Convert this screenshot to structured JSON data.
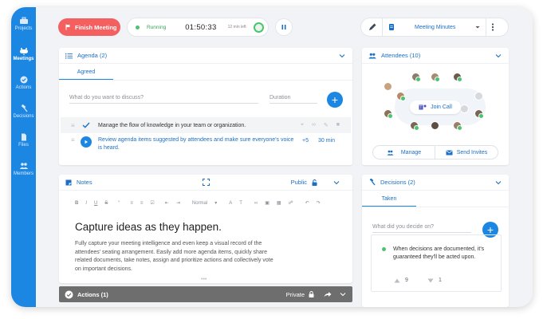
{
  "sidebar": {
    "items": [
      {
        "label": "Projects",
        "icon": "briefcase-icon"
      },
      {
        "label": "Meetings",
        "icon": "meetings-icon",
        "active": true
      },
      {
        "label": "Actions",
        "icon": "check-circle-icon"
      },
      {
        "label": "Decisions",
        "icon": "gavel-icon"
      },
      {
        "label": "Files",
        "icon": "file-icon"
      },
      {
        "label": "Members",
        "icon": "people-icon"
      }
    ]
  },
  "toolbar": {
    "finish_label": "Finish Meeting",
    "status": "Running",
    "clock": "01:50:33",
    "time_left": "12 min left",
    "template_label": "Meeting Minutes"
  },
  "agenda": {
    "title": "Agenda (2)",
    "tab": "Agreed",
    "input_placeholder": "What do you want to discuss?",
    "duration_placeholder": "Duration",
    "items": [
      {
        "text": "Manage the flow of knowledge in your team or organization."
      },
      {
        "text": "Review agenda items suggested by attendees and make sure everyone's voice is heard.",
        "votes": "+5",
        "duration": "30 min"
      }
    ]
  },
  "notes": {
    "title": "Notes",
    "visibility": "Public",
    "format_label": "Normal",
    "heading": "Capture ideas as they happen.",
    "body": "Fully capture your meeting intelligence and even keep a visual record of the attendees' seating arrangement. Easily add more agenda items, quickly share related documents, take notes, assign and prioritize actions and collectively vote on important decisions."
  },
  "actions": {
    "title": "Actions (1)",
    "visibility": "Private"
  },
  "attendees": {
    "title": "Attendees (10)",
    "join_label": "Join Call",
    "manage_label": "Manage",
    "invite_label": "Send Invites"
  },
  "decisions": {
    "title": "Decisions (2)",
    "tab": "Taken",
    "input_placeholder": "What did you decide on?",
    "item_text": "When decisions are documented, it's guaranteed they'll be acted upon.",
    "upvotes": "9",
    "downvotes": "1"
  },
  "colors": {
    "accent": "#1c87e3",
    "finish": "#f46060",
    "running": "#4cc36f"
  }
}
